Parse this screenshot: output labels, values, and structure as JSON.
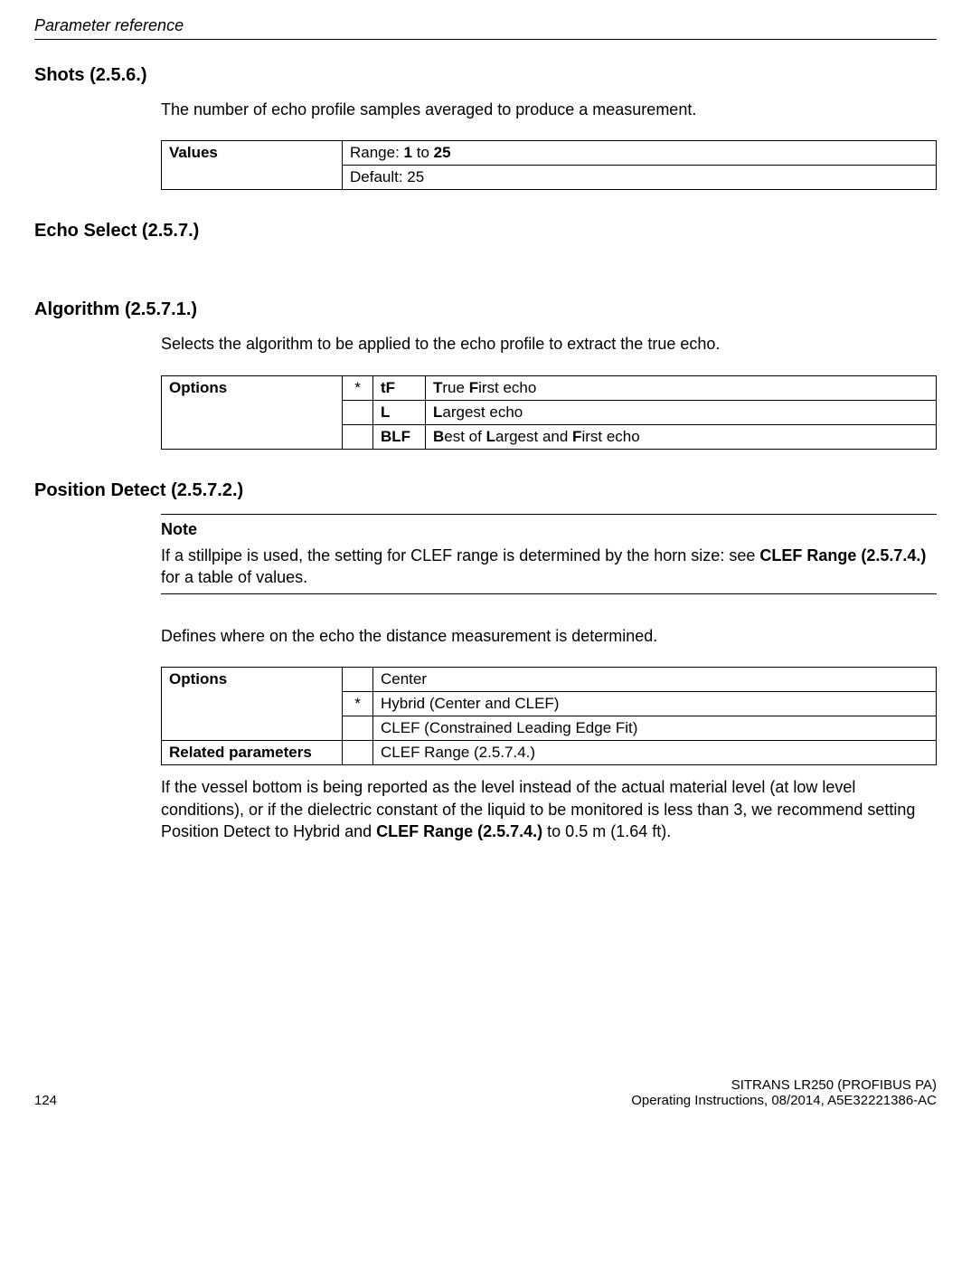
{
  "running_header": "Parameter reference",
  "sections": {
    "shots": {
      "heading": "Shots (2.5.6.)",
      "desc": "The number of echo profile samples averaged to produce a measurement.",
      "table_label": "Values",
      "range_prefix": "Range: ",
      "range_min": "1",
      "range_between": " to ",
      "range_max": "25",
      "default": "Default: 25"
    },
    "echo_select": {
      "heading": "Echo Select (2.5.7.)"
    },
    "algorithm": {
      "heading": "Algorithm (2.5.7.1.)",
      "desc": "Selects the algorithm to be applied to the echo profile to extract the true echo.",
      "table_label": "Options",
      "rows": [
        {
          "star": "*",
          "code": "tF",
          "bold": "T",
          "rest": "rue ",
          "bold2": "F",
          "rest2": "irst echo"
        },
        {
          "star": "",
          "code": "L",
          "bold": "L",
          "rest": "argest echo",
          "bold2": "",
          "rest2": ""
        },
        {
          "star": "",
          "code": "BLF",
          "bold": "B",
          "rest": "est of ",
          "bold2": "L",
          "rest2": "argest and ",
          "bold3": "F",
          "rest3": "irst echo"
        }
      ]
    },
    "position": {
      "heading": "Position Detect (2.5.7.2.)",
      "note_head": "Note",
      "note_pre": "If a stillpipe is used, the setting for CLEF range is determined by the horn size: see ",
      "note_bold": "CLEF Range (2.5.7.4.)",
      "note_post": " for a table of values.",
      "desc": "Defines where on the echo the distance measurement is determined.",
      "table_label": "Options",
      "rows": [
        {
          "star": "",
          "text": "Center"
        },
        {
          "star": "*",
          "text": "Hybrid (Center and CLEF)"
        },
        {
          "star": "",
          "text": "CLEF (Constrained Leading Edge Fit)"
        }
      ],
      "related_label": "Related parameters",
      "related_value": "CLEF Range (2.5.7.4.)",
      "after_pre": "If the vessel bottom is being reported as the level instead of the actual material level (at low level conditions), or if the dielectric constant of the liquid to be monitored is less than 3, we recommend setting Position Detect to Hybrid and ",
      "after_bold": "CLEF Range (2.5.7.4.)",
      "after_post": " to 0.5 m (1.64 ft)."
    }
  },
  "footer": {
    "page_no": "124",
    "right1": "SITRANS LR250 (PROFIBUS PA)",
    "right2": "Operating Instructions, 08/2014, A5E32221386-AC"
  }
}
